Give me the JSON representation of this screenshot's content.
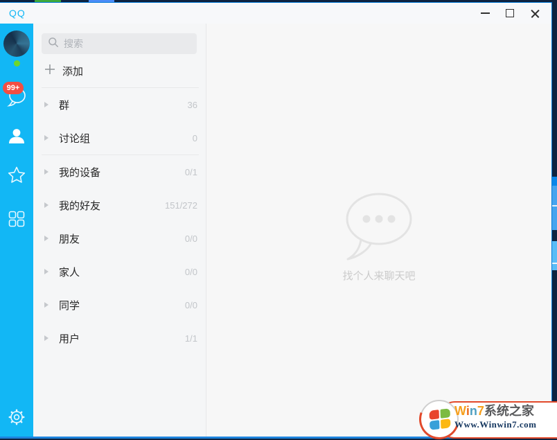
{
  "window": {
    "title": "QQ"
  },
  "rail": {
    "unread_badge": "99+"
  },
  "panel": {
    "search_placeholder": "搜索",
    "add_label": "添加",
    "groups": [
      {
        "label": "群",
        "count": "36"
      },
      {
        "label": "讨论组",
        "count": "0"
      },
      {
        "label": "我的设备",
        "count": "0/1"
      },
      {
        "label": "我的好友",
        "count": "151/272"
      },
      {
        "label": "朋友",
        "count": "0/0"
      },
      {
        "label": "家人",
        "count": "0/0"
      },
      {
        "label": "同学",
        "count": "0/0"
      },
      {
        "label": "用户",
        "count": "1/1"
      }
    ]
  },
  "main": {
    "empty_hint": "找个人来聊天吧"
  },
  "watermark": {
    "win7_letters": [
      {
        "char": "W"
      },
      {
        "char": "i"
      },
      {
        "char": "n"
      },
      {
        "char": "7"
      }
    ],
    "site_name": "系统之家",
    "site_url": "Www.Winwin7.com"
  },
  "colors": {
    "accent_blue": "#12b7f5",
    "window_border": "#0078d7",
    "badge_red": "#f24e43",
    "online_green": "#6fd62a"
  }
}
